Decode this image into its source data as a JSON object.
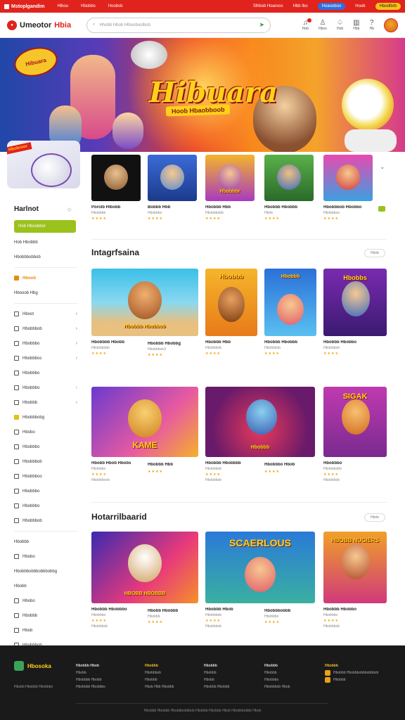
{
  "topbar": {
    "brand": "Mstoplgandim",
    "links": [
      "Hlbou",
      "Hbobbs",
      "Hoobsb"
    ],
    "right_link1": "Slhbsb Hoaroos",
    "right_link2": "Hbb Ibo",
    "pill_blue": "Hoaooboo",
    "link3": "Hoob",
    "pill_yellow": "Hbodlbrb"
  },
  "header": {
    "logo_a": "Umeotor",
    "logo_b": "Hbia",
    "search_placeholder": "Hhobb Hbob Hlbooboolbob"
  },
  "header_icons": [
    "Hob",
    "Hboo",
    "Hob",
    "Hbb",
    "Hb"
  ],
  "hero": {
    "title": "Hibuara",
    "subtitle": "Hoob Hbaobboob",
    "bubble": "Hibuara",
    "badge": "Hbobroor"
  },
  "sidebar": {
    "title": "Harlnot",
    "active": "Hob Hboobbor",
    "group1": [
      "Hob Hbobbb",
      "Hbobbbobbob"
    ],
    "highlight": "Hboob",
    "group2_head": "Hbooob Hbg",
    "group3": [
      "Hboot",
      "Hbobbbob",
      "Hbobbbo",
      "Hbobbbos",
      "Hbobbbo",
      "Hbobbbo",
      "Hbobbb"
    ],
    "group4_head": "Hbobbbobg",
    "group5": [
      "Hbobo",
      "Hbobbbo",
      "Hbobbbob",
      "Hbobbboo",
      "Hbobbbo",
      "Hbobbbo",
      "Hbobbbob"
    ],
    "group6_head": "Hbobbb",
    "group6": [
      "Hbobo",
      "Hbobbbobbbobbbobbg",
      "Hbobb",
      "Hbobo",
      "Hbobbb",
      "Hbob",
      "Hbobbbob"
    ]
  },
  "row1": [
    {
      "name": "Porolb Hlbobb",
      "meta": "Hbobbbb",
      "stars": "★★★★",
      "label": ""
    },
    {
      "name": "Bobbb Hbb",
      "meta": "Hbobbbo",
      "stars": "★★★★",
      "label": ""
    },
    {
      "name": "Hbobbb Hbb",
      "meta": "Hbobbbobb",
      "stars": "★★★★",
      "label": "Hbobbbr"
    },
    {
      "name": "Hbobbb Hbobbb",
      "meta": "Hbob",
      "stars": "★★★★",
      "label": ""
    },
    {
      "name": "Hbobbbob Hbobbo",
      "meta": "Hbobbboo",
      "stars": "★★★★",
      "label": ""
    }
  ],
  "section1": {
    "title": "Intagrfsaina",
    "view": "Hbob"
  },
  "row2": [
    {
      "name": "Hbobbbb Hbobb",
      "meta": "Hbobbbobb",
      "stars": "★★★★",
      "label": "Hbobbb Hbobbob"
    },
    {
      "name": "Hbobbb Hbobbg",
      "meta": "Hbobbbob3",
      "stars": "★★★★",
      "label": ""
    },
    {
      "name": "Hbobbb Hbb",
      "meta": "Hbobbbob",
      "stars": "★★★★",
      "label": "Hbobbb"
    },
    {
      "name": "Hbobbb Hbobbb",
      "meta": "Hbobbbob",
      "stars": "★★★★",
      "label": "Hbobbb"
    },
    {
      "name": "Hbobbb Hbobbo",
      "meta": "Hbobbbob",
      "stars": "★★★★",
      "label": "Hbobbs"
    }
  ],
  "row3": [
    {
      "name": "Hbobb Hbob Hbobs",
      "meta": "Hbobbbo",
      "stars": "★★★★",
      "meta2": "Hbobbboob",
      "label": "KAME"
    },
    {
      "name": "Hbobbb Hbb",
      "meta": "",
      "stars": "★★★★",
      "label": ""
    },
    {
      "name": "Hbobbb Hbobbbb",
      "meta": "Hbobbbob",
      "stars": "★★★★",
      "meta2": "Hbobbbob",
      "label": "Hbobbb"
    },
    {
      "name": "Hbobbbo Hbob",
      "meta": "",
      "stars": "★★★★",
      "label": ""
    },
    {
      "name": "Hbobbbo",
      "meta": "Hbobbbobb",
      "stars": "★★★★",
      "meta2": "Hbobbbob",
      "label": "SIGAK"
    }
  ],
  "section2": {
    "title": "Hotarrilbaarid",
    "view": "Hbob"
  },
  "row4": [
    {
      "name": "Hbobbb Hbobbbo",
      "meta": "Hbobbbo",
      "stars": "★★★★",
      "meta2": "Hbobbbob",
      "label": "HBOBB HBOBBB"
    },
    {
      "name": "Hbobb Hbobbb",
      "meta": "Hbobbb",
      "stars": "★★★★",
      "label": ""
    },
    {
      "name": "Hbobbb Hbob",
      "meta": "Hbobbbob",
      "stars": "★★★★",
      "meta2": "Hbobbbob",
      "label": "SCAERLOUS"
    },
    {
      "name": "Hbobbbobbb",
      "meta": "Hbobbbo",
      "stars": "★★★★",
      "label": ""
    },
    {
      "name": "Hbobbb Hbobbo",
      "meta": "Hbobbbo",
      "stars": "★★★★",
      "meta2": "Hbobbbob",
      "label": "HBOBB NUGIERS"
    }
  ],
  "footer": {
    "logo": "Hbosoka",
    "sub": "Hbobb Hbobbb Hbobbbo",
    "col1": [
      "Hbobbb Hbob",
      "Hbobb",
      "Hbobbbb Hbobb",
      "Hbobbbb Hbobbbo"
    ],
    "col2": [
      "Hbobbb",
      "Hbobbbob",
      "Hbobbb",
      "Hbob Hbb Hbobbb"
    ],
    "col3": [
      "Hbobbb",
      "Hbobbb",
      "Hbobb",
      "Hbobbb Hbobbb"
    ],
    "col4": [
      "Hbobbb",
      "Hbobbb",
      "Hbobbbo",
      "Hbobbbob Hbob"
    ],
    "col5": [
      "Hbobbb",
      "Hbobbb Hbobbbobbbobbbob",
      "Hbobbb"
    ],
    "copy": "Hbobbb Hbobbb Hbobbbobbbob Hbobbb Hbobbb Hbob Hbobbbobbb Hbob"
  },
  "colors": {
    "brand_red": "#e0231d",
    "active_green": "#9bc21c",
    "star": "#f2a100",
    "highlight_orange": "#e88a10"
  }
}
